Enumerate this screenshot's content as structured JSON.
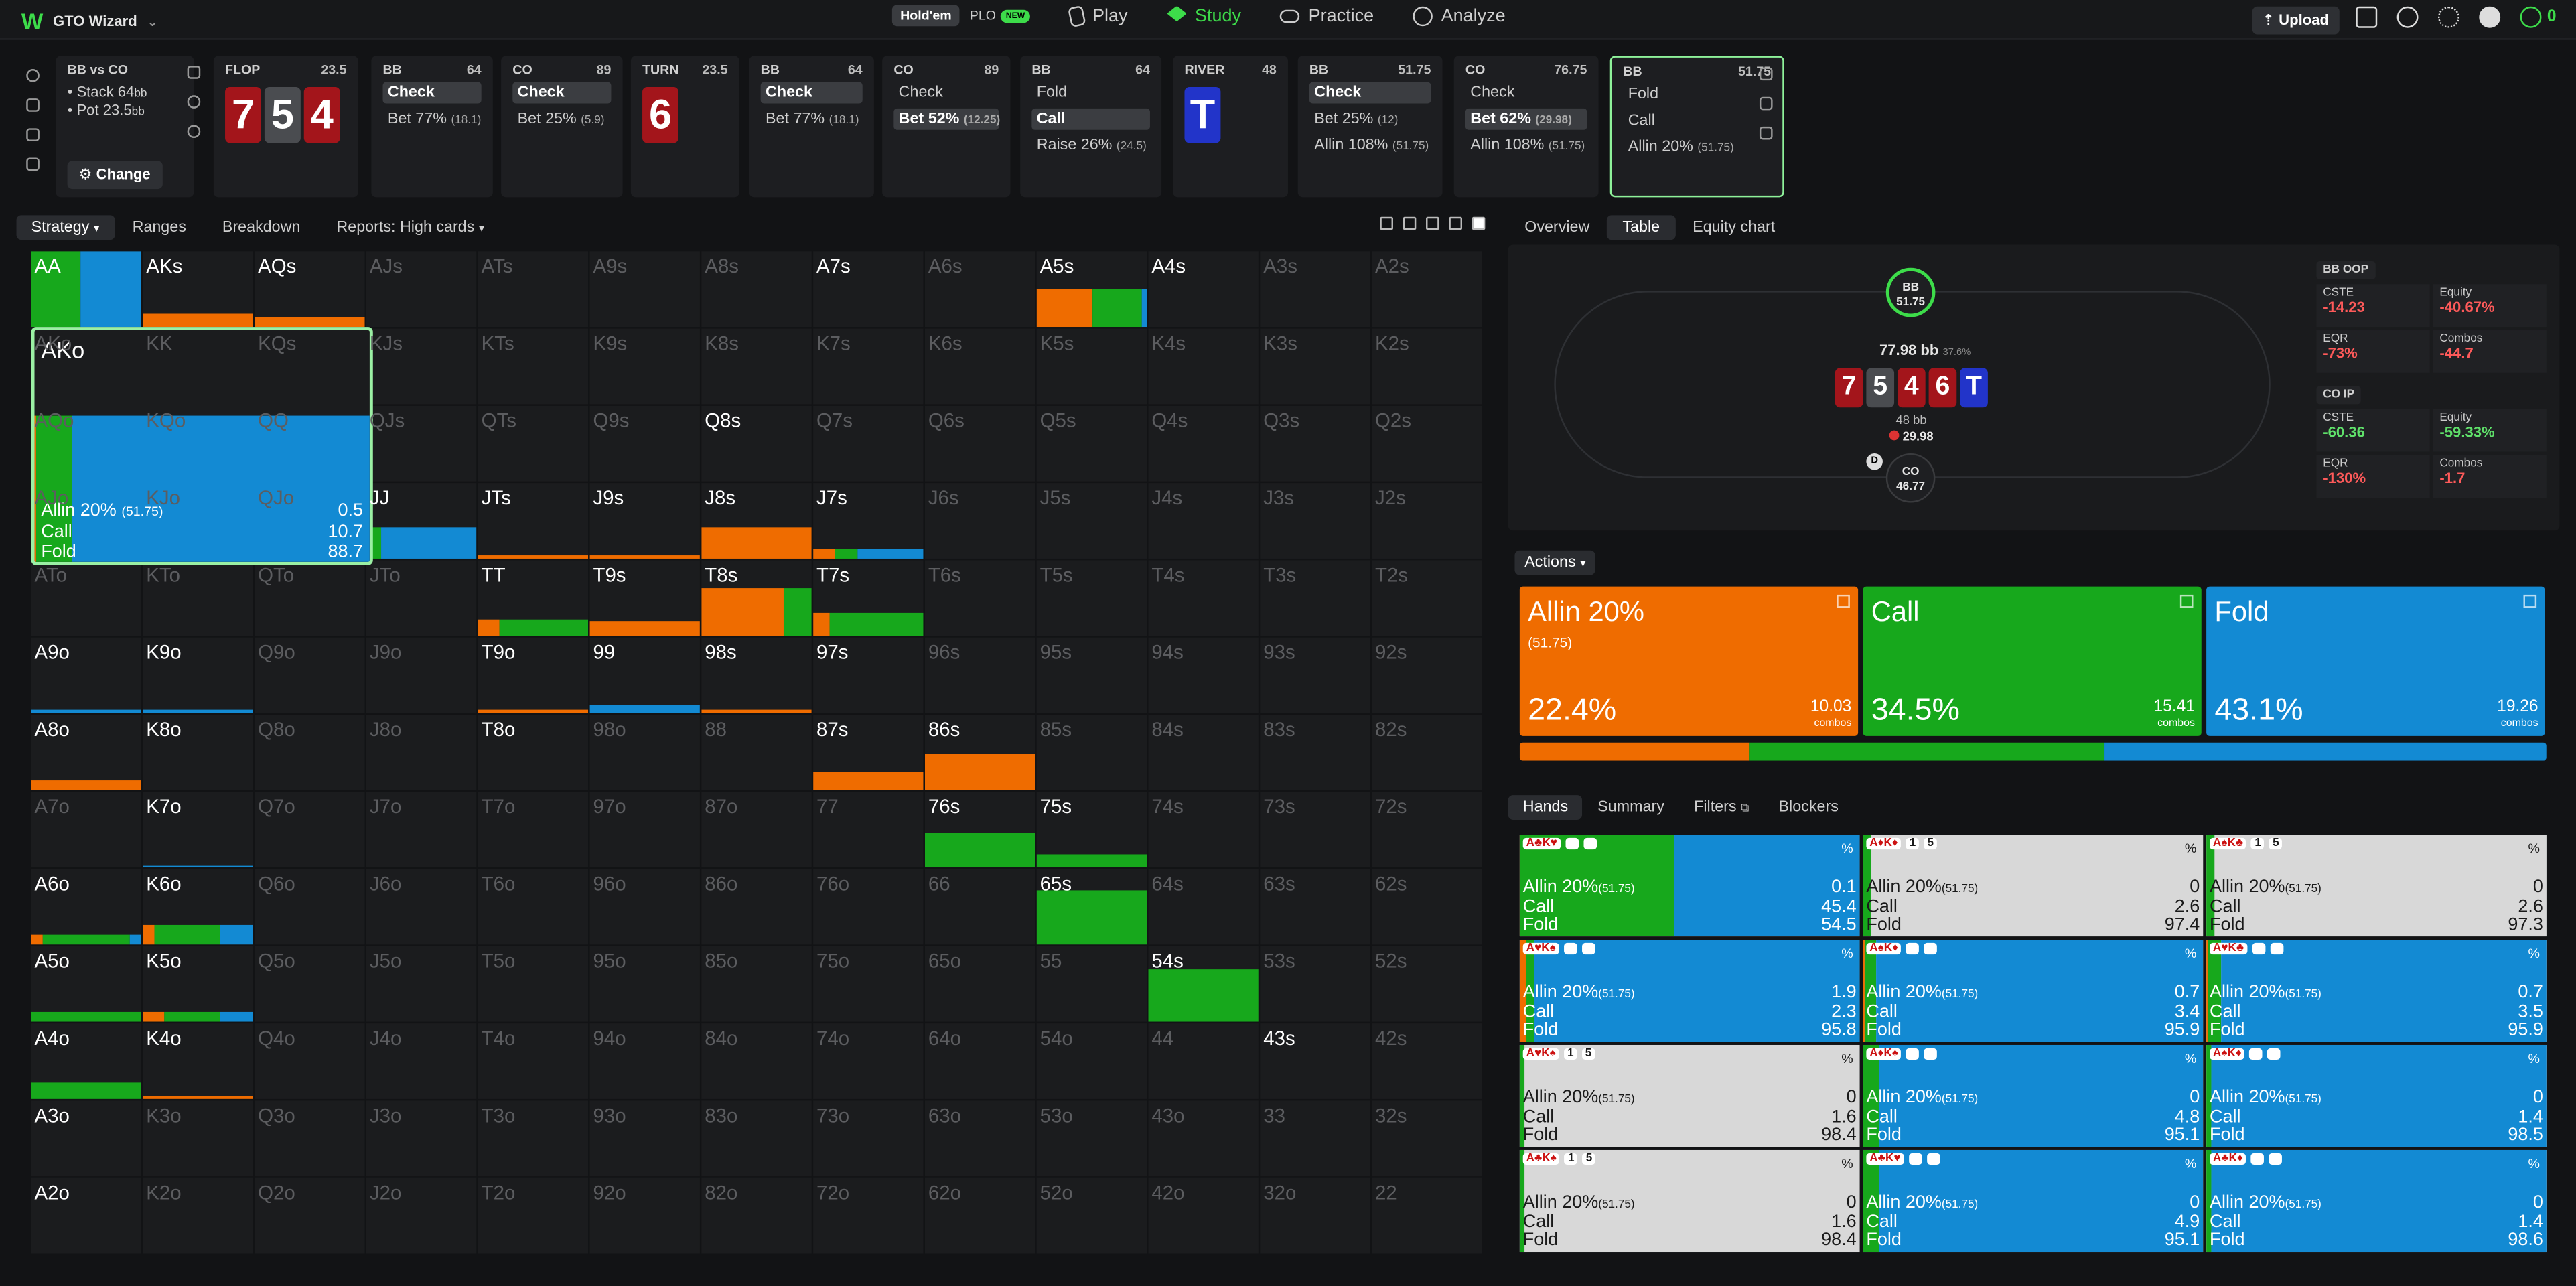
{
  "app": {
    "name": "GTO Wizard",
    "mode_holdem": "Hold'em",
    "mode_plo": "PLO",
    "new_badge": "NEW",
    "nav": [
      "Play",
      "Study",
      "Practice",
      "Analyze"
    ],
    "upload": "Upload"
  },
  "context": {
    "title": "BB vs CO",
    "stack": "Stack 64",
    "stack_unit": "bb",
    "pot": "Pot 23.5",
    "pot_unit": "bb",
    "change": "Change"
  },
  "boxes": [
    {
      "head": "FLOP",
      "num": "23.5",
      "type": "cards",
      "cards": [
        {
          "r": "7",
          "c": "red"
        },
        {
          "r": "5",
          "c": "gray"
        },
        {
          "r": "4",
          "c": "red"
        }
      ]
    },
    {
      "head": "BB",
      "num": "64",
      "actions": [
        {
          "t": "Check",
          "sel": true
        },
        {
          "t": "Bet 77%",
          "s": "(18.1)"
        }
      ]
    },
    {
      "head": "CO",
      "num": "89",
      "actions": [
        {
          "t": "Check",
          "sel": true
        },
        {
          "t": "Bet 25%",
          "s": "(5.9)"
        }
      ]
    },
    {
      "head": "TURN",
      "num": "23.5",
      "type": "cards",
      "cards": [
        {
          "r": "6",
          "c": "red"
        }
      ]
    },
    {
      "head": "BB",
      "num": "64",
      "actions": [
        {
          "t": "Check",
          "sel": true
        },
        {
          "t": "Bet 77%",
          "s": "(18.1)"
        }
      ]
    },
    {
      "head": "CO",
      "num": "89",
      "actions": [
        {
          "t": "Check"
        },
        {
          "t": "Bet 52%",
          "s": "(12.25)",
          "sel": true
        }
      ]
    },
    {
      "head": "BB",
      "num": "64",
      "actions": [
        {
          "t": "Fold"
        },
        {
          "t": "Call",
          "sel": true
        },
        {
          "t": "Raise 26%",
          "s": "(24.5)"
        }
      ]
    },
    {
      "head": "RIVER",
      "num": "48",
      "type": "cards",
      "cards": [
        {
          "r": "T",
          "c": "blue"
        }
      ]
    },
    {
      "head": "BB",
      "num": "51.75",
      "actions": [
        {
          "t": "Check",
          "sel": true
        },
        {
          "t": "Bet 25%",
          "s": "(12)"
        },
        {
          "t": "Allin 108%",
          "s": "(51.75)"
        }
      ]
    },
    {
      "head": "CO",
      "num": "76.75",
      "actions": [
        {
          "t": "Check"
        },
        {
          "t": "Bet 62%",
          "s": "(29.98)",
          "sel": true
        },
        {
          "t": "Allin 108%",
          "s": "(51.75)"
        }
      ]
    },
    {
      "head": "BB",
      "num": "51.75",
      "actions": [
        {
          "t": "Fold"
        },
        {
          "t": "Call"
        },
        {
          "t": "Allin 20%",
          "s": "(51.75)"
        }
      ],
      "selected": true
    }
  ],
  "strategy_tabs": [
    "Strategy",
    "Ranges",
    "Breakdown",
    "Reports: High cards"
  ],
  "grid": [
    [
      "AA",
      "AKs",
      "AQs",
      "AJs",
      "ATs",
      "A9s",
      "A8s",
      "A7s",
      "A6s",
      "A5s",
      "A4s",
      "A3s",
      "A2s"
    ],
    [
      "AKo",
      "KK",
      "KQs",
      "KJs",
      "KTs",
      "K9s",
      "K8s",
      "K7s",
      "K6s",
      "K5s",
      "K4s",
      "K3s",
      "K2s"
    ],
    [
      "AQo",
      "KQo",
      "QQ",
      "QJs",
      "QTs",
      "Q9s",
      "Q8s",
      "Q7s",
      "Q6s",
      "Q5s",
      "Q4s",
      "Q3s",
      "Q2s"
    ],
    [
      "AJo",
      "KJo",
      "QJo",
      "JJ",
      "JTs",
      "J9s",
      "J8s",
      "J7s",
      "J6s",
      "J5s",
      "J4s",
      "J3s",
      "J2s"
    ],
    [
      "ATo",
      "KTo",
      "QTo",
      "JTo",
      "TT",
      "T9s",
      "T8s",
      "T7s",
      "T6s",
      "T5s",
      "T4s",
      "T3s",
      "T2s"
    ],
    [
      "A9o",
      "K9o",
      "Q9o",
      "J9o",
      "T9o",
      "99",
      "98s",
      "97s",
      "96s",
      "95s",
      "94s",
      "93s",
      "92s"
    ],
    [
      "A8o",
      "K8o",
      "Q8o",
      "J8o",
      "T8o",
      "98o",
      "88",
      "87s",
      "86s",
      "85s",
      "84s",
      "83s",
      "82s"
    ],
    [
      "A7o",
      "K7o",
      "Q7o",
      "J7o",
      "T7o",
      "97o",
      "87o",
      "77",
      "76s",
      "75s",
      "74s",
      "73s",
      "72s"
    ],
    [
      "A6o",
      "K6o",
      "Q6o",
      "J6o",
      "T6o",
      "96o",
      "86o",
      "76o",
      "66",
      "65s",
      "64s",
      "63s",
      "62s"
    ],
    [
      "A5o",
      "K5o",
      "Q5o",
      "J5o",
      "T5o",
      "95o",
      "85o",
      "75o",
      "65o",
      "55",
      "54s",
      "53s",
      "52s"
    ],
    [
      "A4o",
      "K4o",
      "Q4o",
      "J4o",
      "T4o",
      "94o",
      "84o",
      "74o",
      "64o",
      "54o",
      "44",
      "43s",
      "42s"
    ],
    [
      "A3o",
      "K3o",
      "Q3o",
      "J3o",
      "T3o",
      "93o",
      "83o",
      "73o",
      "63o",
      "53o",
      "43o",
      "33",
      "32s"
    ],
    [
      "A2o",
      "K2o",
      "Q2o",
      "J2o",
      "T2o",
      "92o",
      "82o",
      "72o",
      "62o",
      "52o",
      "42o",
      "32o",
      "22"
    ]
  ],
  "active": [
    "AA",
    "AKs",
    "AQs",
    "A7s",
    "A5s",
    "A4s",
    "Q8s",
    "JJ",
    "JTs",
    "J9s",
    "J8s",
    "J7s",
    "TT",
    "T9s",
    "T8s",
    "T7s",
    "A9o",
    "K9o",
    "T9o",
    "99",
    "98s",
    "97s",
    "A8o",
    "K8o",
    "T8o",
    "87s",
    "86s",
    "K7o",
    "76s",
    "75s",
    "A6o",
    "K6o",
    "65s",
    "A5o",
    "K5o",
    "54s",
    "A4o",
    "K4o",
    "43s",
    "A3o",
    "A2o"
  ],
  "ako": {
    "name": "AKo",
    "rows": [
      {
        "a": "Allin 20%",
        "s": "(51.75)",
        "v": "0.5"
      },
      {
        "a": "Call",
        "v": "10.7"
      },
      {
        "a": "Fold",
        "v": "88.7"
      }
    ],
    "freq": {
      "allin": 0.5,
      "call": 10.7,
      "fold": 88.7
    }
  },
  "right_tabs": [
    "Overview",
    "Table",
    "Equity chart"
  ],
  "table": {
    "bb_seat": "BB",
    "bb_stack": "51.75",
    "co_seat": "CO",
    "co_stack": "46.77",
    "pot": "77.98 bb",
    "pot_pct": "37.6%",
    "bet": "48 bb",
    "chip": "29.98",
    "dealer": "D",
    "board": [
      {
        "r": "7",
        "c": "red"
      },
      {
        "r": "5",
        "c": "gray"
      },
      {
        "r": "4",
        "c": "red"
      },
      {
        "r": "6",
        "c": "red"
      },
      {
        "r": "T",
        "c": "blue"
      }
    ]
  },
  "stats": [
    {
      "player": "BB",
      "pos": "OOP",
      "cste": "-14.23",
      "equity": "-40.67%",
      "eqr": "-73%",
      "combos": "-44.7"
    },
    {
      "player": "CO",
      "pos": "IP",
      "cste": "-60.36",
      "equity": "-59.33%",
      "eqr": "-130%",
      "combos": "-1.7"
    }
  ],
  "stat_labels": {
    "cste": "CSTE",
    "equity": "Equity",
    "eqr": "EQR",
    "combos": "Combos"
  },
  "actions_label": "Actions",
  "actions": [
    {
      "name": "Allin 20%",
      "size": "(51.75)",
      "pct": "22.4%",
      "combos": "10.03",
      "unit": "combos",
      "color": "#ef6c00"
    },
    {
      "name": "Call",
      "size": "",
      "pct": "34.5%",
      "combos": "15.41",
      "unit": "combos",
      "color": "#17a81c"
    },
    {
      "name": "Fold",
      "size": "",
      "pct": "43.1%",
      "combos": "19.26",
      "unit": "combos",
      "color": "#138ad3"
    }
  ],
  "freq": {
    "allin": 22.4,
    "call": 34.5,
    "fold": 43.1
  },
  "hand_tabs": [
    "Hands",
    "Summary",
    "Filters",
    "Blockers"
  ],
  "hands": [
    {
      "cards": "A♣K♥",
      "b1": "1",
      "b2": "4",
      "allin": "0.1",
      "call": "45.4",
      "fold": "54.5"
    },
    {
      "cards": "A♦K♦",
      "b1": "1",
      "b2": "5",
      "allin": "0",
      "call": "2.6",
      "fold": "97.4"
    },
    {
      "cards": "A♠K♣",
      "b1": "1",
      "b2": "5",
      "allin": "0",
      "call": "2.6",
      "fold": "97.3"
    },
    {
      "cards": "A♥K♠",
      "b1": "1",
      "b2": "4",
      "allin": "1.9",
      "call": "2.3",
      "fold": "95.8"
    },
    {
      "cards": "A♠K♦",
      "b1": "1",
      "b2": "4",
      "allin": "0.7",
      "call": "3.4",
      "fold": "95.9"
    },
    {
      "cards": "A♥K♣",
      "b1": "1",
      "b2": "4",
      "allin": "0.7",
      "call": "3.5",
      "fold": "95.9"
    },
    {
      "cards": "A♥K♠",
      "b1": "1",
      "b2": "5",
      "allin": "0",
      "call": "1.6",
      "fold": "98.4"
    },
    {
      "cards": "A♦K♠",
      "b1": "1",
      "b2": "4",
      "allin": "0",
      "call": "4.8",
      "fold": "95.1"
    },
    {
      "cards": "A♠K♦",
      "b1": "1",
      "b2": "5",
      "allin": "0",
      "call": "1.4",
      "fold": "98.5"
    },
    {
      "cards": "A♣K♠",
      "b1": "1",
      "b2": "5",
      "allin": "0",
      "call": "1.6",
      "fold": "98.4"
    },
    {
      "cards": "A♣K♥",
      "b1": "1",
      "b2": "4",
      "allin": "0",
      "call": "4.9",
      "fold": "95.1"
    },
    {
      "cards": "A♣K♦",
      "b1": "1",
      "b2": "5",
      "allin": "0",
      "call": "1.4",
      "fold": "98.6"
    }
  ],
  "hand_labels": {
    "allin": "Allin 20%",
    "allin_size": "(51.75)",
    "call": "Call",
    "fold": "Fold",
    "pct": "%"
  }
}
